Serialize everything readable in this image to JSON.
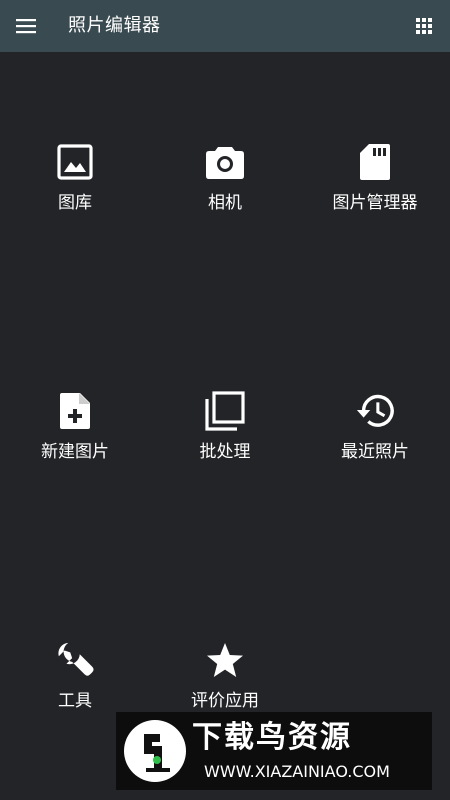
{
  "header": {
    "title": "照片编辑器",
    "menu_icon": "hamburger-menu-icon",
    "apps_icon": "grid-apps-icon"
  },
  "tiles": [
    {
      "label": "图库",
      "icon": "image-icon"
    },
    {
      "label": "相机",
      "icon": "camera-icon"
    },
    {
      "label": "图片管理器",
      "icon": "sd-card-icon"
    },
    {
      "label": "新建图片",
      "icon": "new-file-icon"
    },
    {
      "label": "批处理",
      "icon": "batch-copy-icon"
    },
    {
      "label": "最近照片",
      "icon": "history-icon"
    },
    {
      "label": "工具",
      "icon": "wrench-icon"
    },
    {
      "label": "评价应用",
      "icon": "star-icon"
    }
  ],
  "watermark": {
    "title": "下载鸟资源",
    "url": "WWW.XIAZAINIAO.COM"
  },
  "colors": {
    "background": "#222427",
    "header": "#394a50",
    "text": "#ffffff"
  }
}
